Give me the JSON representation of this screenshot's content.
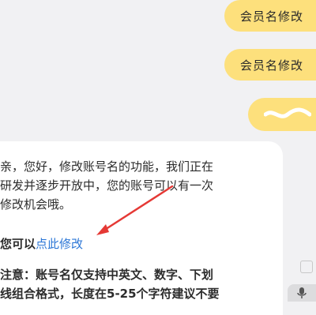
{
  "chat": {
    "outgoing": [
      {
        "text": "会员名修改"
      },
      {
        "text": "会员名修改"
      }
    ],
    "reply": {
      "intro_lines": [
        "亲，您好，修改账号名的功能，我们正在",
        "研发并逐步开放中，您的账号可以有一次",
        "修改机会哦。"
      ],
      "link_prefix": "您可以",
      "link_text": "点此修改",
      "notice_lines": [
        "注意：账号名仅支持中英文、数字、下划",
        "线组合格式，长度在5-25个字符建议不要"
      ]
    }
  },
  "annotation": {
    "arrow_color": "#e53935"
  },
  "colors": {
    "outgoing_bubble": "#fde07c",
    "link": "#2b76d6"
  },
  "icons": [
    "wave-icon",
    "microphone-icon",
    "watermark-logo-icon",
    "annotation-arrow-icon"
  ]
}
